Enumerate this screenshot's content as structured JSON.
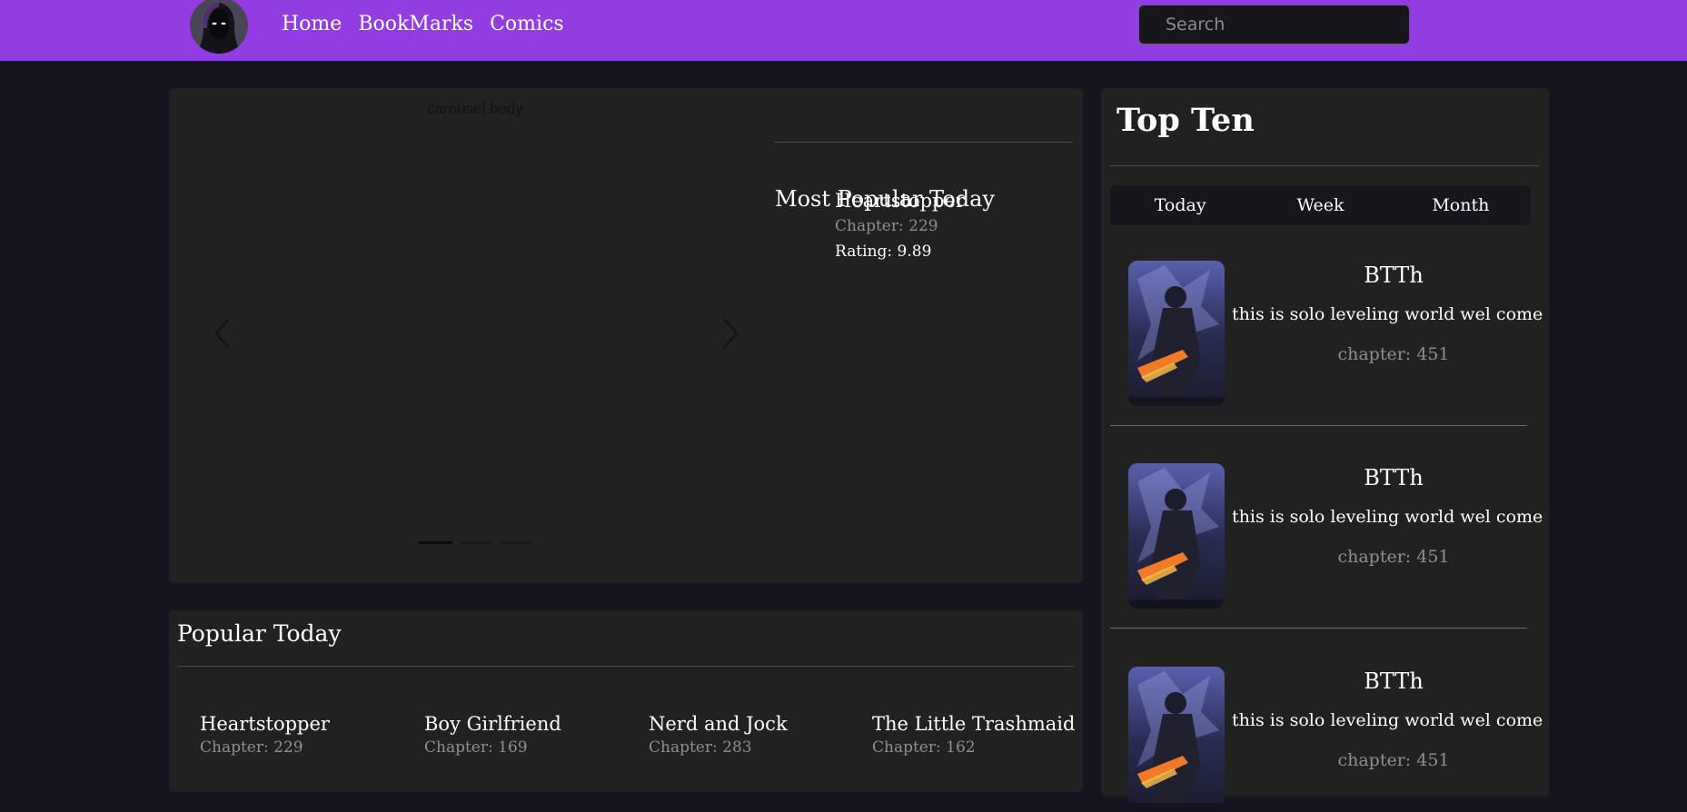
{
  "nav": {
    "links": [
      "Home",
      "BookMarks",
      "Comics"
    ],
    "search_placeholder": "Search",
    "accent_color": "#913de2"
  },
  "carousel": {
    "body_text": "carousel body",
    "indicator_count": 3,
    "active_index": 0
  },
  "most_popular_today": {
    "title": "Most Popular Today",
    "name": "Heartstopper",
    "chapter": "Chapter: 229",
    "rating": "Rating: 9.89"
  },
  "popular_today": {
    "title": "Popular Today",
    "items": [
      {
        "name": "Heartstopper",
        "chapter": "Chapter: 229"
      },
      {
        "name": "Boy Girlfriend",
        "chapter": "Chapter: 169"
      },
      {
        "name": "Nerd and Jock",
        "chapter": "Chapter: 283"
      },
      {
        "name": "The Little Trashmaid",
        "chapter": "Chapter: 162"
      }
    ]
  },
  "top_ten": {
    "title": "Top Ten",
    "tabs": [
      "Today",
      "Week",
      "Month"
    ],
    "items": [
      {
        "name": "BTTh",
        "description": "this is solo leveling world wel come",
        "chapter": "chapter: 451"
      },
      {
        "name": "BTTh",
        "description": "this is solo leveling world wel come",
        "chapter": "chapter: 451"
      },
      {
        "name": "BTTh",
        "description": "this is solo leveling world wel come",
        "chapter": "chapter: 451"
      }
    ]
  }
}
